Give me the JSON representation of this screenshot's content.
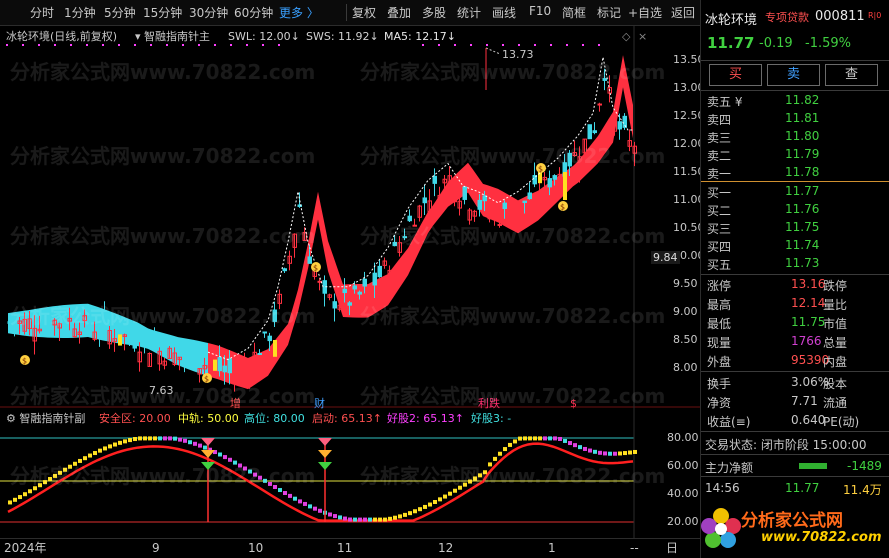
{
  "toolbar": {
    "items": [
      "分时",
      "1分钟",
      "5分钟",
      "15分钟",
      "30分钟",
      "60分钟",
      "更多 〉",
      "复权",
      "叠加",
      "多股",
      "统计",
      "画线",
      "F10",
      "简框",
      "标记",
      "+自选",
      "返回"
    ]
  },
  "main_header": {
    "stock": "冰轮环境(日线,前复权)",
    "indicator": "智融指南针主",
    "sws": "SWL: 12.00↓",
    "sws2": "SWS: 11.92↓",
    "ma5": "MA5: 12.17↓"
  },
  "main_axis": {
    "ticks": [
      "13.50",
      "13.00",
      "12.50",
      "12.00",
      "11.50",
      "11.00",
      "10.50",
      "10.00",
      "9.50",
      "9.00",
      "8.50",
      "8.00"
    ],
    "crosshair_value": "9.84"
  },
  "annotations": {
    "high": "13.73",
    "low": "7.63",
    "zeng": "增",
    "cai": "财",
    "li_die": "利跌",
    "s_mark": "$"
  },
  "sub_header": {
    "name": "智融指南针副",
    "safe": "安全区: 20.00",
    "mid": "中轨: 50.00",
    "high": "高位: 80.00",
    "start": "启动: 65.13↑",
    "good2": "好股2: 65.13↑",
    "good3": "好股3: -"
  },
  "sub_axis": {
    "ticks": [
      "80.00",
      "60.00",
      "40.00",
      "20.00"
    ]
  },
  "x_axis": {
    "labels": [
      "2024年",
      "9",
      "10",
      "11",
      "12",
      "1"
    ],
    "right": "--",
    "bottom_right": "日"
  },
  "quote": {
    "name": "冰轮环境",
    "promo": "专项贷款",
    "code": "000811",
    "flag": "R|0",
    "price": "11.77",
    "change": "-0.19",
    "pct": "-1.59%",
    "buy": "买",
    "sell": "卖",
    "check": "查"
  },
  "asks": [
    {
      "label": "卖五",
      "extra": "¥",
      "price": "11.82"
    },
    {
      "label": "卖四",
      "extra": "",
      "price": "11.81"
    },
    {
      "label": "卖三",
      "extra": "",
      "price": "11.80"
    },
    {
      "label": "卖二",
      "extra": "",
      "price": "11.79"
    },
    {
      "label": "卖一",
      "extra": "",
      "price": "11.78"
    }
  ],
  "bids": [
    {
      "label": "买一",
      "price": "11.77"
    },
    {
      "label": "买二",
      "price": "11.76"
    },
    {
      "label": "买三",
      "price": "11.75"
    },
    {
      "label": "买四",
      "price": "11.74"
    },
    {
      "label": "买五",
      "price": "11.73"
    }
  ],
  "stats": [
    {
      "k": "涨停",
      "v": "13.16",
      "k2": "跌停"
    },
    {
      "k": "最高",
      "v": "12.14",
      "k2": "量比"
    },
    {
      "k": "最低",
      "v": "11.75",
      "k2": "市值"
    },
    {
      "k": "现量",
      "v": "1766",
      "k2": "总量"
    },
    {
      "k": "外盘",
      "v": "95390",
      "k2": "内盘"
    }
  ],
  "stats2": [
    {
      "k": "换手",
      "v": "3.06%",
      "k2": "股本"
    },
    {
      "k": "净资",
      "v": "7.71",
      "k2": "流通"
    },
    {
      "k": "收益(≡)",
      "v": "0.640",
      "k2": "PE(动)"
    }
  ],
  "trade_state": "交易状态: 闭市阶段 15:00:00",
  "flow": {
    "label": "主力净额",
    "value": "-1489"
  },
  "tick": {
    "time": "14:56",
    "price": "11.77",
    "vol": "11.4万"
  },
  "watermark": "分析家公式网www.70822.com",
  "logo": {
    "text": "分析家公式网",
    "url": "www.70822.com"
  }
}
